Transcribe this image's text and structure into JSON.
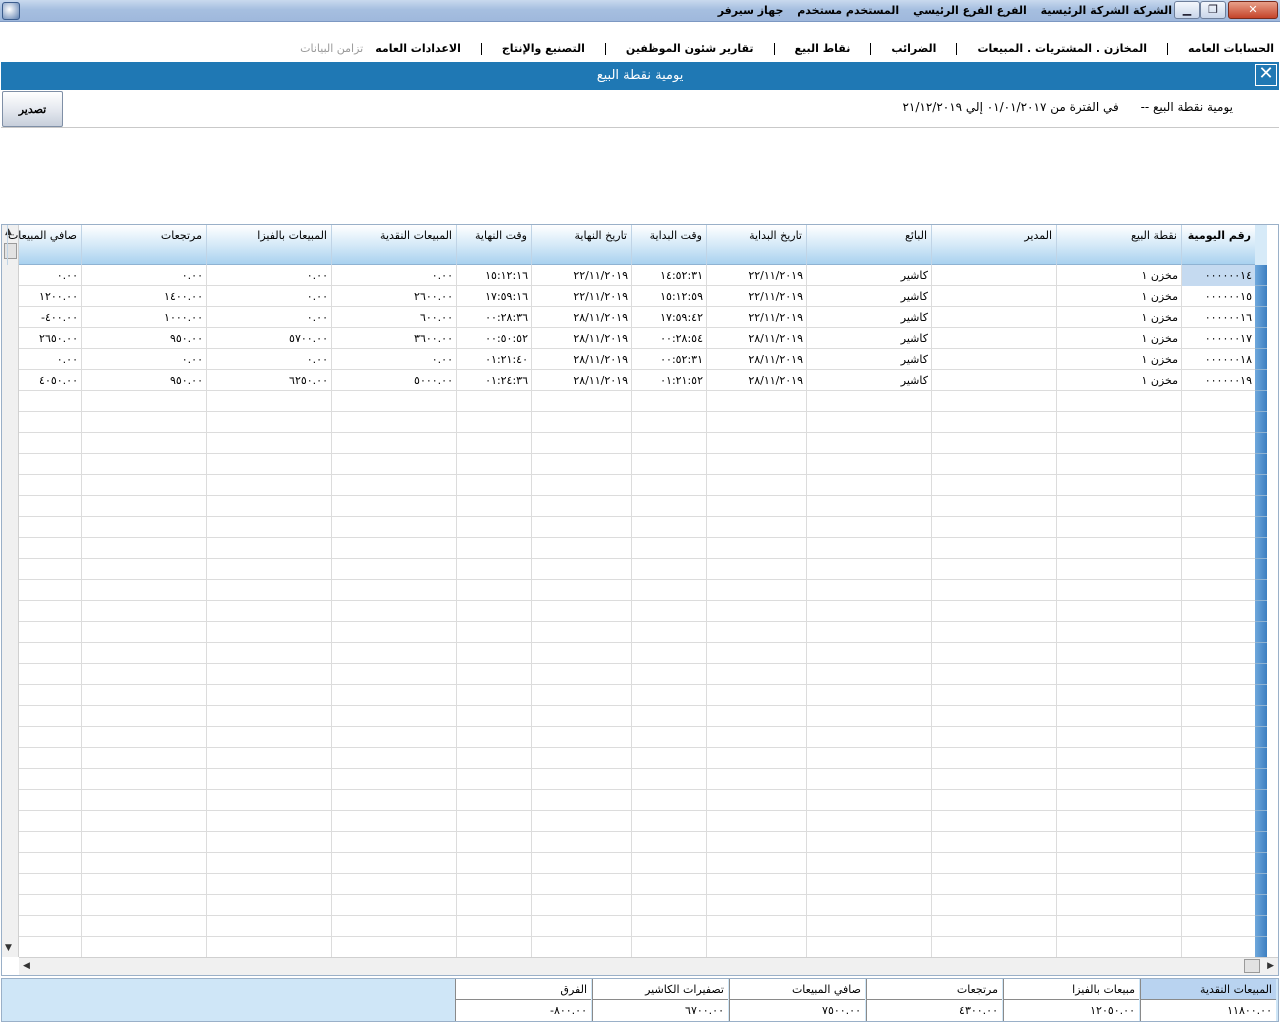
{
  "titlebar": {
    "company": "الشركة الشركة الرئيسية",
    "branch": "الفرع الفرع الرئيسي",
    "user": "المستخدم مستخدم",
    "device": "جهاز سيرفر",
    "minimize_glyph": "▁",
    "maximize_glyph": "❐",
    "close_glyph": "✕"
  },
  "menu": {
    "items": [
      {
        "label": "الحسابات العامه",
        "enabled": true
      },
      {
        "label": "المخازن . المشتريات . المبيعات",
        "enabled": true
      },
      {
        "label": "الضرائب",
        "enabled": true
      },
      {
        "label": "نقاط البيع",
        "enabled": true
      },
      {
        "label": "تقارير شئون الموظفين",
        "enabled": true
      },
      {
        "label": "التصنيع والإنتاج",
        "enabled": true
      },
      {
        "label": "الاعدادات العامه",
        "enabled": true
      },
      {
        "label": "تزامن البيانات",
        "enabled": false
      }
    ]
  },
  "window": {
    "title": "يومية نقطة البيع",
    "close_glyph": "✕"
  },
  "filter": {
    "export_label": "تصدير",
    "report_name": "يومية نقطة البيع --",
    "period_text": "في الفترة من ٠١/٠١/٢٠١٧ إلي ٢١/١٢/٢٠١٩"
  },
  "grid": {
    "columns": [
      {
        "label": "رقم اليومية",
        "width": 74,
        "bold": true
      },
      {
        "label": "نقطة البيع",
        "width": 125,
        "bold": false
      },
      {
        "label": "المدير",
        "width": 125,
        "bold": false
      },
      {
        "label": "البائع",
        "width": 125,
        "bold": false
      },
      {
        "label": "تاريخ البداية",
        "width": 100,
        "bold": false
      },
      {
        "label": "وقت البداية",
        "width": 75,
        "bold": false
      },
      {
        "label": "تاريخ النهاية",
        "width": 100,
        "bold": false
      },
      {
        "label": "وقت النهاية",
        "width": 75,
        "bold": false
      },
      {
        "label": "المبيعات النقدية",
        "width": 125,
        "bold": false
      },
      {
        "label": "المبيعات بالفيزا",
        "width": 125,
        "bold": false
      },
      {
        "label": "مرتجعات",
        "width": 125,
        "bold": false
      },
      {
        "label": "صافي المبيعات",
        "width": 74,
        "bold": false
      }
    ],
    "rows": [
      [
        "٠٠٠٠٠٠١٤",
        "مخزن ١",
        "",
        "كاشير",
        "٢٢/١١/٢٠١٩",
        "١٤:٥٢:٣١",
        "٢٢/١١/٢٠١٩",
        "١٥:١٢:١٦",
        "٠.٠٠",
        "٠.٠٠",
        "٠.٠٠",
        "٠.٠٠"
      ],
      [
        "٠٠٠٠٠٠١٥",
        "مخزن ١",
        "",
        "كاشير",
        "٢٢/١١/٢٠١٩",
        "١٥:١٢:٥٩",
        "٢٢/١١/٢٠١٩",
        "١٧:٥٩:١٦",
        "٢٦٠٠.٠٠",
        "٠.٠٠",
        "١٤٠٠.٠٠",
        "١٢٠٠.٠٠"
      ],
      [
        "٠٠٠٠٠٠١٦",
        "مخزن ١",
        "",
        "كاشير",
        "٢٢/١١/٢٠١٩",
        "١٧:٥٩:٤٢",
        "٢٨/١١/٢٠١٩",
        "٠٠:٢٨:٣٦",
        "٦٠٠.٠٠",
        "٠.٠٠",
        "١٠٠٠.٠٠",
        "٤٠٠.٠٠-"
      ],
      [
        "٠٠٠٠٠٠١٧",
        "مخزن ١",
        "",
        "كاشير",
        "٢٨/١١/٢٠١٩",
        "٠٠:٢٨:٥٤",
        "٢٨/١١/٢٠١٩",
        "٠٠:٥٠:٥٢",
        "٣٦٠٠.٠٠",
        "٥٧٠٠.٠٠",
        "٩٥٠.٠٠",
        "٢٦٥٠.٠٠"
      ],
      [
        "٠٠٠٠٠٠١٨",
        "مخزن ١",
        "",
        "كاشير",
        "٢٨/١١/٢٠١٩",
        "٠٠:٥٢:٣١",
        "٢٨/١١/٢٠١٩",
        "٠١:٢١:٤٠",
        "٠.٠٠",
        "٠.٠٠",
        "٠.٠٠",
        "٠.٠٠"
      ],
      [
        "٠٠٠٠٠٠١٩",
        "مخزن ١",
        "",
        "كاشير",
        "٢٨/١١/٢٠١٩",
        "٠١:٢١:٥٢",
        "٢٨/١١/٢٠١٩",
        "٠١:٢٤:٣٦",
        "٥٠٠٠.٠٠",
        "٦٢٥٠.٠٠",
        "٩٥٠.٠٠",
        "٤٠٥٠.٠٠"
      ]
    ],
    "empty_rows": 27,
    "scroll_up_glyph": "▲",
    "scroll_down_glyph": "▼",
    "scroll_left_glyph": "◀",
    "scroll_right_glyph": "▶"
  },
  "summary": {
    "items": [
      {
        "label": "المبيعات النقدية",
        "value": "١١٨٠٠.٠٠",
        "highlight": true
      },
      {
        "label": "مبيعات بالفيزا",
        "value": "١٢٠٥٠.٠٠",
        "highlight": false
      },
      {
        "label": "مرتجعات",
        "value": "٤٣٠٠.٠٠",
        "highlight": false
      },
      {
        "label": "صافي المبيعات",
        "value": "٧٥٠٠.٠٠",
        "highlight": false
      },
      {
        "label": "تصفيرات الكاشير",
        "value": "٦٧٠٠.٠٠",
        "highlight": false
      },
      {
        "label": "الفرق",
        "value": "٨٠٠.٠٠-",
        "highlight": false
      }
    ]
  }
}
